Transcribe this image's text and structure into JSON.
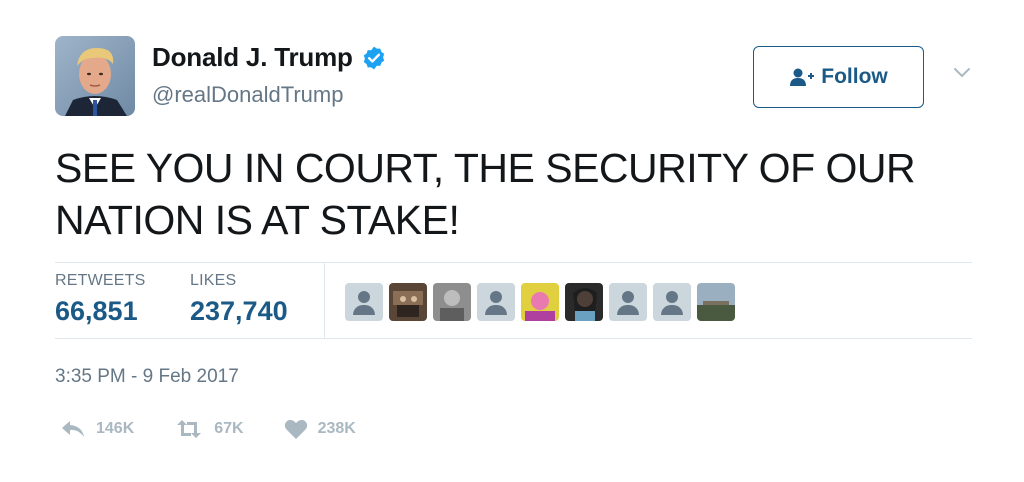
{
  "user": {
    "name": "Donald J. Trump",
    "handle": "@realDonaldTrump",
    "verified_icon": "verified-badge-icon"
  },
  "follow_button": {
    "label": "Follow",
    "icon": "add-user-icon"
  },
  "tweet": {
    "text": "SEE YOU IN COURT, THE SECURITY OF OUR NATION IS AT STAKE!"
  },
  "stats": {
    "retweets_label": "RETWEETS",
    "retweets_value": "66,851",
    "likes_label": "LIKES",
    "likes_value": "237,740"
  },
  "timestamp": "3:35 PM - 9 Feb 2017",
  "actions": {
    "reply_count": "146K",
    "retweet_count": "67K",
    "like_count": "238K"
  },
  "colors": {
    "accent": "#1b5a87",
    "verified": "#1da1f2",
    "muted": "#657786",
    "icon": "#aab8c2"
  }
}
